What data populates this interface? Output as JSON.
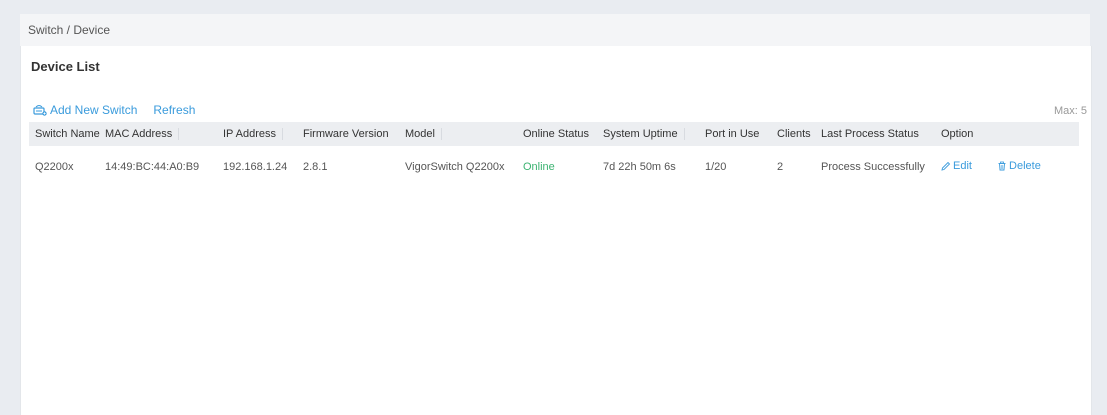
{
  "breadcrumb": "Switch / Device",
  "panel": {
    "title": "Device List",
    "add_label": "Add New Switch",
    "refresh_label": "Refresh",
    "max_label": "Max: 5"
  },
  "table": {
    "headers": [
      "Switch Name",
      "MAC Address",
      "IP Address",
      "Firmware Version",
      "Model",
      "Online Status",
      "System Uptime",
      "Port in Use",
      "Clients",
      "Last Process Status",
      "Option"
    ],
    "rows": [
      {
        "name": "Q2200x",
        "mac": "14:49:BC:44:A0:B9",
        "ip": "192.168.1.24",
        "firmware": "2.8.1",
        "model": "VigorSwitch Q2200x",
        "online": "Online",
        "uptime": "7d 22h 50m 6s",
        "ports": "1/20",
        "clients": "2",
        "last_status": "Process Successfully",
        "edit_label": "Edit",
        "delete_label": "Delete"
      }
    ]
  },
  "colors": {
    "accent": "#3a9bdc",
    "online": "#3cb371"
  }
}
